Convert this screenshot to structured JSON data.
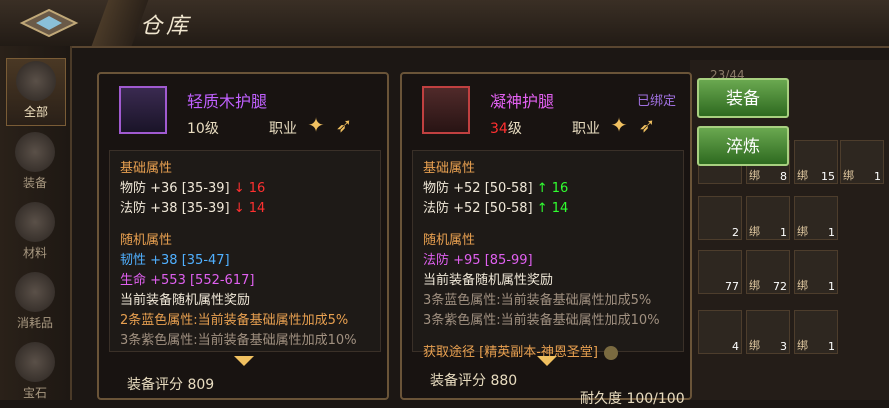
{
  "header": {
    "title": "仓库"
  },
  "sidebar": {
    "items": [
      {
        "label": "全部"
      },
      {
        "label": "装备"
      },
      {
        "label": "材料"
      },
      {
        "label": "消耗品"
      },
      {
        "label": "宝石"
      }
    ]
  },
  "item_left": {
    "name": "轻质木护腿",
    "level": "10级",
    "job_label": "职业",
    "base_title": "基础属性",
    "base_attrs": [
      {
        "text": "物防 +36 [35-39]",
        "delta": "↓ 16"
      },
      {
        "text": "法防 +38 [35-39]",
        "delta": "↓ 14"
      }
    ],
    "random_title": "随机属性",
    "random_attrs": [
      "韧性 +38 [35-47]",
      "生命 +553 [552-617]"
    ],
    "bonus_title": "当前装备随机属性奖励",
    "bonus_lines": [
      "2条蓝色属性:当前装备基础属性加成5%",
      "3条紫色属性:当前装备基础属性加成10%"
    ],
    "score": "装备评分 809"
  },
  "item_right": {
    "name": "凝神护腿",
    "bound": "已绑定",
    "level_num": "34",
    "level_unit": "级",
    "job_label": "职业",
    "base_title": "基础属性",
    "base_attrs": [
      {
        "text": "物防 +52 [50-58]",
        "delta": "↑ 16"
      },
      {
        "text": "法防 +52 [50-58]",
        "delta": "↑ 14"
      }
    ],
    "random_title": "随机属性",
    "random_attrs": [
      "法防 +95 [85-99]"
    ],
    "bonus_title": "当前装备随机属性奖励",
    "bonus_lines": [
      "3条蓝色属性:当前装备基础属性加成5%",
      "3条紫色属性:当前装备基础属性加成10%"
    ],
    "source": "获取途径 [精英副本-神恩圣堂]",
    "score": "装备评分 880",
    "durability": "耐久度 100/100"
  },
  "actions": {
    "equip": "装备",
    "refine": "淬炼"
  },
  "grid": {
    "cells": [
      {
        "bind": "",
        "count": ""
      },
      {
        "bind": "绑",
        "count": "8"
      },
      {
        "bind": "绑",
        "count": "15"
      },
      {
        "bind": "绑",
        "count": "1"
      },
      {
        "bind": "",
        "count": "2"
      },
      {
        "bind": "绑",
        "count": "1"
      },
      {
        "bind": "绑",
        "count": "1"
      },
      {
        "bind": "",
        "count": "77"
      },
      {
        "bind": "绑",
        "count": "72"
      },
      {
        "bind": "绑",
        "count": "1"
      },
      {
        "bind": "",
        "count": "4"
      },
      {
        "bind": "绑",
        "count": "3"
      },
      {
        "bind": "绑",
        "count": "1"
      }
    ],
    "header_count": "23/44"
  }
}
